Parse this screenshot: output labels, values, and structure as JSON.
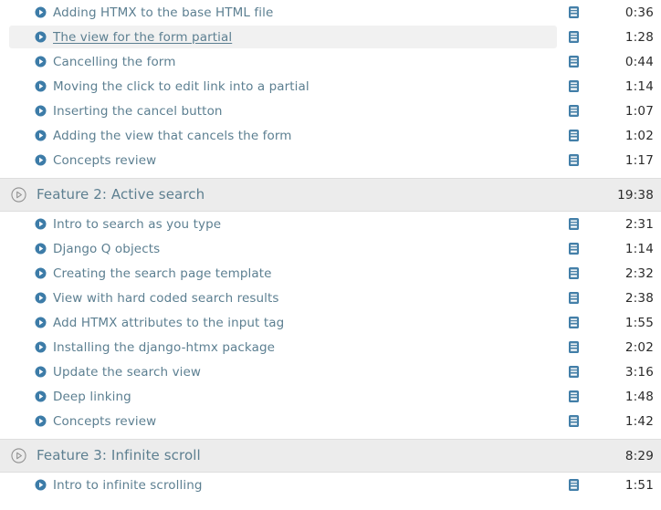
{
  "icons": {
    "play_solid": "play-circle-filled-icon",
    "play_outline": "play-circle-outline-icon",
    "note": "transcript-note-icon"
  },
  "colors": {
    "link_text": "#5c7f91",
    "section_title": "#5d7f90",
    "duration_text": "#2b2b2b",
    "section_background": "#ececec",
    "section_border": "#dedede",
    "row_hover_background": "#f1f1f1",
    "icon_blue": "#3d7ca8",
    "icon_outline_gray": "#8c8c8c",
    "page_background": "#ffffff"
  },
  "blocks": [
    {
      "kind": "lessons",
      "items": [
        {
          "title": "Adding HTMX to the base HTML file",
          "duration": "0:36",
          "has_note": true,
          "active": false
        },
        {
          "title": "The view for the form partial",
          "duration": "1:28",
          "has_note": true,
          "active": true
        },
        {
          "title": "Cancelling the form",
          "duration": "0:44",
          "has_note": true,
          "active": false
        },
        {
          "title": "Moving the click to edit link into a partial",
          "duration": "1:14",
          "has_note": true,
          "active": false
        },
        {
          "title": "Inserting the cancel button",
          "duration": "1:07",
          "has_note": true,
          "active": false
        },
        {
          "title": "Adding the view that cancels the form",
          "duration": "1:02",
          "has_note": true,
          "active": false
        },
        {
          "title": "Concepts review",
          "duration": "1:17",
          "has_note": true,
          "active": false
        }
      ]
    },
    {
      "kind": "section",
      "title": "Feature 2: Active search",
      "duration": "19:38"
    },
    {
      "kind": "lessons",
      "items": [
        {
          "title": "Intro to search as you type",
          "duration": "2:31",
          "has_note": true,
          "active": false
        },
        {
          "title": "Django Q objects",
          "duration": "1:14",
          "has_note": true,
          "active": false
        },
        {
          "title": "Creating the search page template",
          "duration": "2:32",
          "has_note": true,
          "active": false
        },
        {
          "title": "View with hard coded search results",
          "duration": "2:38",
          "has_note": true,
          "active": false
        },
        {
          "title": "Add HTMX attributes to the input tag",
          "duration": "1:55",
          "has_note": true,
          "active": false
        },
        {
          "title": "Installing the django-htmx package",
          "duration": "2:02",
          "has_note": true,
          "active": false
        },
        {
          "title": "Update the search view",
          "duration": "3:16",
          "has_note": true,
          "active": false
        },
        {
          "title": "Deep linking",
          "duration": "1:48",
          "has_note": true,
          "active": false
        },
        {
          "title": "Concepts review",
          "duration": "1:42",
          "has_note": true,
          "active": false
        }
      ]
    },
    {
      "kind": "section",
      "title": "Feature 3: Infinite scroll",
      "duration": "8:29"
    },
    {
      "kind": "lessons",
      "items": [
        {
          "title": "Intro to infinite scrolling",
          "duration": "1:51",
          "has_note": true,
          "active": false
        }
      ]
    }
  ]
}
